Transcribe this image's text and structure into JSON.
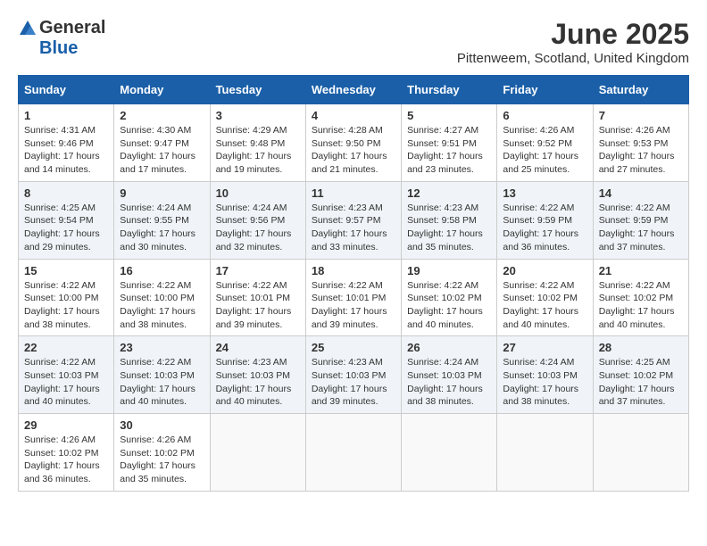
{
  "logo": {
    "general": "General",
    "blue": "Blue"
  },
  "title": {
    "month_year": "June 2025",
    "location": "Pittenweem, Scotland, United Kingdom"
  },
  "weekdays": [
    "Sunday",
    "Monday",
    "Tuesday",
    "Wednesday",
    "Thursday",
    "Friday",
    "Saturday"
  ],
  "weeks": [
    [
      {
        "day": "1",
        "sunrise": "4:31 AM",
        "sunset": "9:46 PM",
        "daylight": "17 hours and 14 minutes."
      },
      {
        "day": "2",
        "sunrise": "4:30 AM",
        "sunset": "9:47 PM",
        "daylight": "17 hours and 17 minutes."
      },
      {
        "day": "3",
        "sunrise": "4:29 AM",
        "sunset": "9:48 PM",
        "daylight": "17 hours and 19 minutes."
      },
      {
        "day": "4",
        "sunrise": "4:28 AM",
        "sunset": "9:50 PM",
        "daylight": "17 hours and 21 minutes."
      },
      {
        "day": "5",
        "sunrise": "4:27 AM",
        "sunset": "9:51 PM",
        "daylight": "17 hours and 23 minutes."
      },
      {
        "day": "6",
        "sunrise": "4:26 AM",
        "sunset": "9:52 PM",
        "daylight": "17 hours and 25 minutes."
      },
      {
        "day": "7",
        "sunrise": "4:26 AM",
        "sunset": "9:53 PM",
        "daylight": "17 hours and 27 minutes."
      }
    ],
    [
      {
        "day": "8",
        "sunrise": "4:25 AM",
        "sunset": "9:54 PM",
        "daylight": "17 hours and 29 minutes."
      },
      {
        "day": "9",
        "sunrise": "4:24 AM",
        "sunset": "9:55 PM",
        "daylight": "17 hours and 30 minutes."
      },
      {
        "day": "10",
        "sunrise": "4:24 AM",
        "sunset": "9:56 PM",
        "daylight": "17 hours and 32 minutes."
      },
      {
        "day": "11",
        "sunrise": "4:23 AM",
        "sunset": "9:57 PM",
        "daylight": "17 hours and 33 minutes."
      },
      {
        "day": "12",
        "sunrise": "4:23 AM",
        "sunset": "9:58 PM",
        "daylight": "17 hours and 35 minutes."
      },
      {
        "day": "13",
        "sunrise": "4:22 AM",
        "sunset": "9:59 PM",
        "daylight": "17 hours and 36 minutes."
      },
      {
        "day": "14",
        "sunrise": "4:22 AM",
        "sunset": "9:59 PM",
        "daylight": "17 hours and 37 minutes."
      }
    ],
    [
      {
        "day": "15",
        "sunrise": "4:22 AM",
        "sunset": "10:00 PM",
        "daylight": "17 hours and 38 minutes."
      },
      {
        "day": "16",
        "sunrise": "4:22 AM",
        "sunset": "10:00 PM",
        "daylight": "17 hours and 38 minutes."
      },
      {
        "day": "17",
        "sunrise": "4:22 AM",
        "sunset": "10:01 PM",
        "daylight": "17 hours and 39 minutes."
      },
      {
        "day": "18",
        "sunrise": "4:22 AM",
        "sunset": "10:01 PM",
        "daylight": "17 hours and 39 minutes."
      },
      {
        "day": "19",
        "sunrise": "4:22 AM",
        "sunset": "10:02 PM",
        "daylight": "17 hours and 40 minutes."
      },
      {
        "day": "20",
        "sunrise": "4:22 AM",
        "sunset": "10:02 PM",
        "daylight": "17 hours and 40 minutes."
      },
      {
        "day": "21",
        "sunrise": "4:22 AM",
        "sunset": "10:02 PM",
        "daylight": "17 hours and 40 minutes."
      }
    ],
    [
      {
        "day": "22",
        "sunrise": "4:22 AM",
        "sunset": "10:03 PM",
        "daylight": "17 hours and 40 minutes."
      },
      {
        "day": "23",
        "sunrise": "4:22 AM",
        "sunset": "10:03 PM",
        "daylight": "17 hours and 40 minutes."
      },
      {
        "day": "24",
        "sunrise": "4:23 AM",
        "sunset": "10:03 PM",
        "daylight": "17 hours and 40 minutes."
      },
      {
        "day": "25",
        "sunrise": "4:23 AM",
        "sunset": "10:03 PM",
        "daylight": "17 hours and 39 minutes."
      },
      {
        "day": "26",
        "sunrise": "4:24 AM",
        "sunset": "10:03 PM",
        "daylight": "17 hours and 38 minutes."
      },
      {
        "day": "27",
        "sunrise": "4:24 AM",
        "sunset": "10:03 PM",
        "daylight": "17 hours and 38 minutes."
      },
      {
        "day": "28",
        "sunrise": "4:25 AM",
        "sunset": "10:02 PM",
        "daylight": "17 hours and 37 minutes."
      }
    ],
    [
      {
        "day": "29",
        "sunrise": "4:26 AM",
        "sunset": "10:02 PM",
        "daylight": "17 hours and 36 minutes."
      },
      {
        "day": "30",
        "sunrise": "4:26 AM",
        "sunset": "10:02 PM",
        "daylight": "17 hours and 35 minutes."
      },
      null,
      null,
      null,
      null,
      null
    ]
  ],
  "labels": {
    "sunrise": "Sunrise:",
    "sunset": "Sunset:",
    "daylight": "Daylight:"
  }
}
